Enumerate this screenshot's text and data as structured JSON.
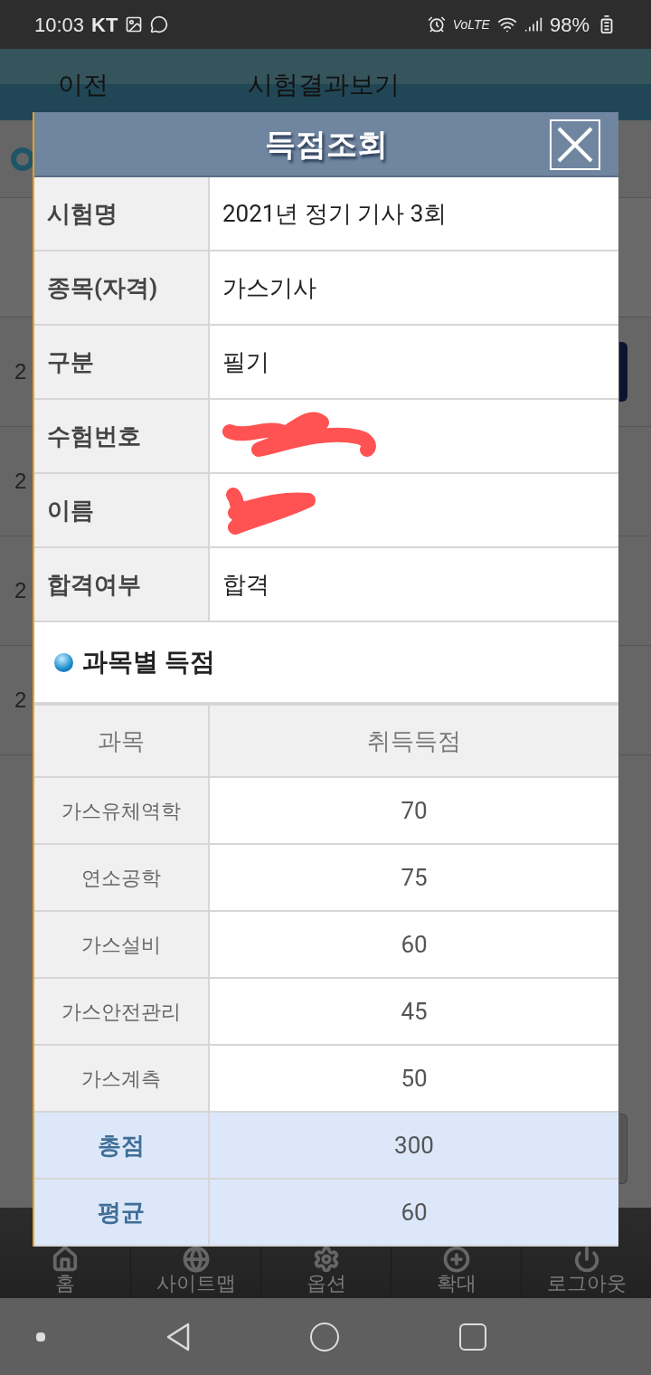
{
  "status_bar": {
    "time": "10:03",
    "carrier": "KT",
    "network": "VoLTE",
    "battery": "98%"
  },
  "header": {
    "back": "이전",
    "title": "시험결과보기"
  },
  "background": {
    "rows": [
      "2",
      "2",
      "2",
      "2"
    ]
  },
  "dialog": {
    "title": "득점조회",
    "info": [
      {
        "label": "시험명",
        "value": "2021년 정기 기사 3회",
        "redacted": false
      },
      {
        "label": "종목(자격)",
        "value": "가스기사",
        "redacted": false
      },
      {
        "label": "구분",
        "value": "필기",
        "redacted": false
      },
      {
        "label": "수험번호",
        "redacted": true
      },
      {
        "label": "이름",
        "redacted": true
      },
      {
        "label": "합격여부",
        "value": "합격",
        "redacted": false
      }
    ],
    "section_title": "과목별 득점",
    "scores": {
      "columns": [
        "과목",
        "취득득점"
      ],
      "rows": [
        {
          "subject": "가스유체역학",
          "score": "70",
          "kind": "subject"
        },
        {
          "subject": "연소공학",
          "score": "75",
          "kind": "subject"
        },
        {
          "subject": "가스설비",
          "score": "60",
          "kind": "subject"
        },
        {
          "subject": "가스안전관리",
          "score": "45",
          "kind": "subject"
        },
        {
          "subject": "가스계측",
          "score": "50",
          "kind": "subject"
        },
        {
          "subject": "총점",
          "score": "300",
          "kind": "summary"
        },
        {
          "subject": "평균",
          "score": "60",
          "kind": "summary"
        }
      ]
    }
  },
  "bottom_nav": [
    "홈",
    "사이트맵",
    "옵션",
    "확대",
    "로그아웃"
  ]
}
